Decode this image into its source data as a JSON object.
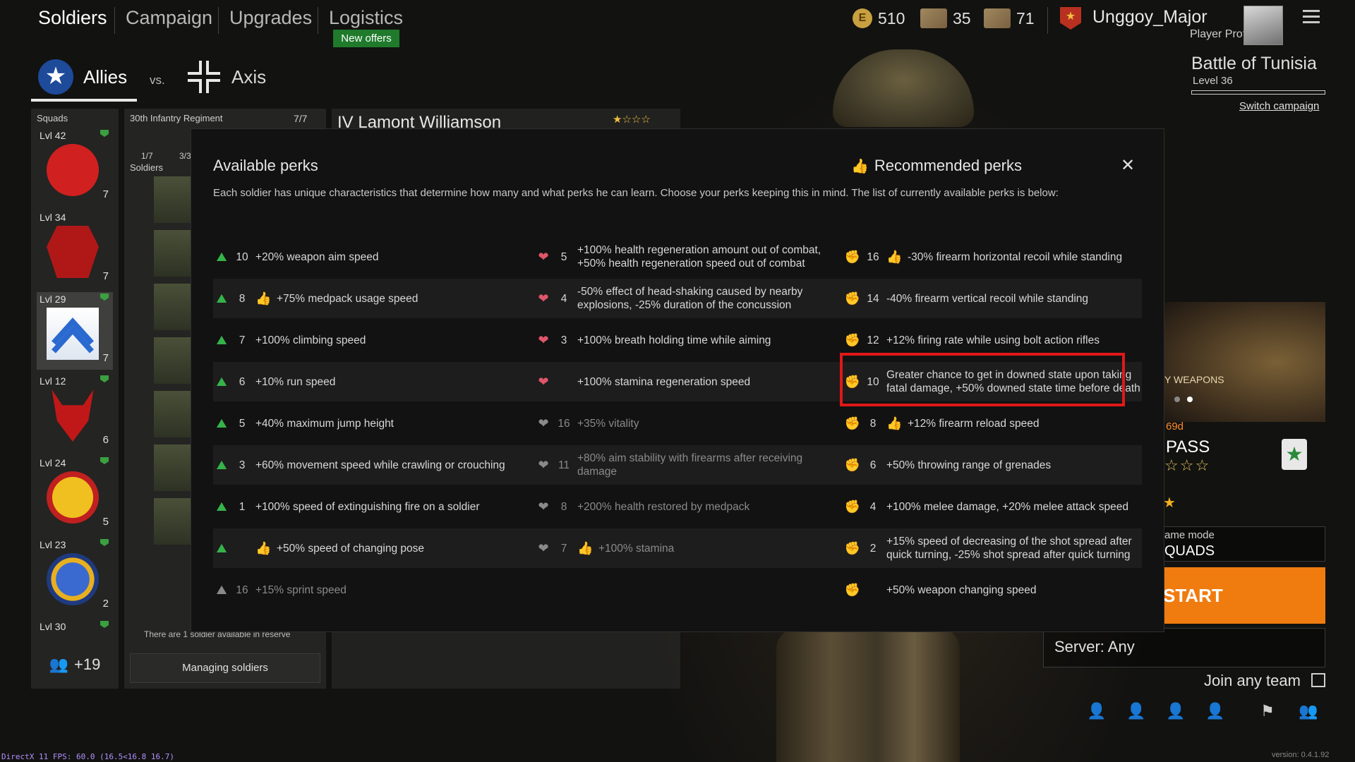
{
  "nav": {
    "tabs": [
      "Soldiers",
      "Campaign",
      "Upgrades",
      "Logistics"
    ],
    "new_offers": "New offers"
  },
  "currencies": [
    {
      "icon": "coin-icon",
      "symbol": "E",
      "value": "510"
    },
    {
      "icon": "card-icon",
      "value": "35"
    },
    {
      "icon": "card-icon",
      "value": "71"
    }
  ],
  "player": {
    "name": "Unggoy_Major",
    "profile_label": "Player Profile"
  },
  "factions": {
    "allies": "Allies",
    "vs": "vs.",
    "axis": "Axis"
  },
  "campaign": {
    "title": "Battle of Tunisia",
    "level": "Level 36",
    "switch_label": "Switch campaign",
    "banner_text": "Y WEAPONS",
    "pass_days": "69d",
    "pass_label": "PASS",
    "game_mode_label": "ame mode",
    "game_mode_value": "QUADS",
    "start_label": "START",
    "server_label": "Server: Any",
    "join_any_team": "Join any team",
    "version": "version: 0.4.1.92"
  },
  "debug": {
    "fps": "DirectX 11 FPS: 60.0 (16.5<16.8 16.7)"
  },
  "squads": {
    "title": "Squads",
    "items": [
      {
        "level": "Lvl 42",
        "count": "7"
      },
      {
        "level": "Lvl 34",
        "count": "7"
      },
      {
        "level": "Lvl 29",
        "count": "7"
      },
      {
        "level": "Lvl 12",
        "count": "6"
      },
      {
        "level": "Lvl 24",
        "count": "5"
      },
      {
        "level": "Lvl 23",
        "count": "2"
      },
      {
        "level": "Lvl 30",
        "count": ""
      }
    ],
    "more": "+19"
  },
  "soldiers": {
    "regiment": "30th Infantry Regiment",
    "regiment_count": "7/7",
    "title": "Soldiers",
    "class_counts": [
      "1/7",
      "3/3"
    ],
    "reserve_text": "There are 1 soldier available in reserve",
    "managing_label": "Managing soldiers"
  },
  "detail": {
    "name": "IV Lamont Williamson",
    "stars": "★☆☆☆"
  },
  "modal": {
    "title": "Available perks",
    "recommended": "Recommended perks",
    "description": "Each soldier has unique characteristics that determine how many and what perks he can learn. Choose your perks keeping this in mind. The list of currently available perks is below:",
    "rows": [
      [
        {
          "cost": "10",
          "text": "+20% weapon aim speed",
          "rec": false,
          "dim": false
        },
        {
          "cost": "5",
          "text": "+100% health regeneration amount out of combat, +50% health regeneration speed out of combat",
          "rec": false,
          "dim": false
        },
        {
          "cost": "16",
          "text": "-30% firearm horizontal recoil while standing",
          "rec": true,
          "dim": false
        }
      ],
      [
        {
          "cost": "8",
          "text": "+75% medpack usage speed",
          "rec": true,
          "dim": false
        },
        {
          "cost": "4",
          "text": "-50% effect of head-shaking caused by nearby explosions, -25% duration of the concussion",
          "rec": false,
          "dim": false
        },
        {
          "cost": "14",
          "text": "-40% firearm vertical recoil while standing",
          "rec": false,
          "dim": false
        }
      ],
      [
        {
          "cost": "7",
          "text": "+100% climbing speed",
          "rec": false,
          "dim": false
        },
        {
          "cost": "3",
          "text": "+100% breath holding time while aiming",
          "rec": false,
          "dim": false
        },
        {
          "cost": "12",
          "text": "+12% firing rate while using bolt action rifles",
          "rec": false,
          "dim": false
        }
      ],
      [
        {
          "cost": "6",
          "text": "+10% run speed",
          "rec": false,
          "dim": false
        },
        {
          "cost": "",
          "text": "+100% stamina regeneration speed",
          "rec": false,
          "dim": false
        },
        {
          "cost": "10",
          "text": "Greater chance to get in downed state upon taking fatal damage, +50% downed state time before death",
          "rec": false,
          "dim": false
        }
      ],
      [
        {
          "cost": "5",
          "text": "+40% maximum jump height",
          "rec": false,
          "dim": false
        },
        {
          "cost": "16",
          "text": "+35% vitality",
          "rec": false,
          "dim": true
        },
        {
          "cost": "8",
          "text": "+12% firearm reload speed",
          "rec": true,
          "dim": false
        }
      ],
      [
        {
          "cost": "3",
          "text": "+60% movement speed while crawling or crouching",
          "rec": false,
          "dim": false
        },
        {
          "cost": "11",
          "text": "+80% aim stability with firearms after receiving damage",
          "rec": false,
          "dim": true
        },
        {
          "cost": "6",
          "text": "+50% throwing range of grenades",
          "rec": false,
          "dim": false
        }
      ],
      [
        {
          "cost": "1",
          "text": "+100% speed of extinguishing fire on a soldier",
          "rec": false,
          "dim": false
        },
        {
          "cost": "8",
          "text": "+200% health restored by medpack",
          "rec": false,
          "dim": true
        },
        {
          "cost": "4",
          "text": "+100% melee damage, +20% melee attack speed",
          "rec": false,
          "dim": false
        }
      ],
      [
        {
          "cost": "",
          "text": "+50% speed of changing pose",
          "rec": true,
          "dim": false
        },
        {
          "cost": "7",
          "text": "+100% stamina",
          "rec": true,
          "dim": true
        },
        {
          "cost": "2",
          "text": "+15% speed of decreasing of the shot spread after quick turning, -25% shot spread after quick turning",
          "rec": false,
          "dim": false
        }
      ],
      [
        {
          "cost": "16",
          "text": "+15% sprint speed",
          "rec": false,
          "dim": true
        },
        null,
        {
          "cost": "",
          "text": "+50% weapon changing speed",
          "rec": false,
          "dim": false
        }
      ]
    ]
  },
  "colors": {
    "accent_orange": "#f07c10",
    "perk_agility": "#35b34a",
    "perk_vitality": "#e0556a",
    "perk_strength": "#e6c85a",
    "highlight": "#e01818"
  }
}
